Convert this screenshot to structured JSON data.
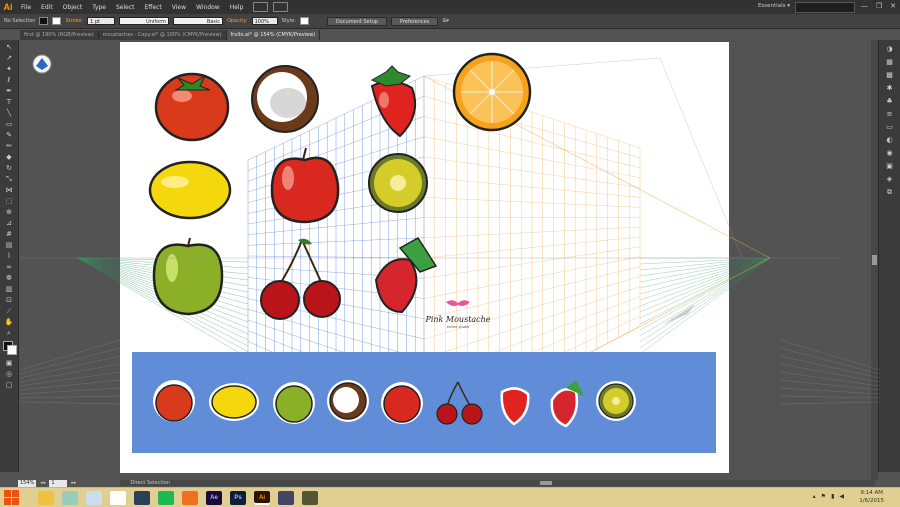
{
  "app": {
    "logo": "Ai"
  },
  "menu": [
    "File",
    "Edit",
    "Object",
    "Type",
    "Select",
    "Effect",
    "View",
    "Window",
    "Help"
  ],
  "workspace": {
    "label": "Essentials ▾",
    "search_placeholder": ""
  },
  "window_buttons": {
    "minimize": "—",
    "restore": "❐",
    "close": "✕"
  },
  "control_bar": {
    "selection": "No Selection",
    "stroke_label": "Stroke:",
    "stroke_weight": "1 pt",
    "profile": "Uniform",
    "brush": "Basic",
    "opacity_label": "Opacity:",
    "opacity_value": "100%",
    "style_label": "Style:",
    "doc_setup": "Document Setup",
    "preferences": "Preferences"
  },
  "tabs": [
    {
      "label": "first @ 190% (RGB/Preview)"
    },
    {
      "label": "moustaches · Copy.ai* @ 100% (CMYK/Preview)"
    },
    {
      "label": "fruits.ai* @ 154% (CMYK/Preview)"
    }
  ],
  "canvas": {
    "brand_name": "Pink Moustache",
    "brand_tagline": "online studio",
    "fruits_top": [
      "tomato",
      "coconut",
      "strawberry",
      "orange",
      "lemon",
      "apple",
      "kiwi",
      "green-apple",
      "cherries",
      "raspberry"
    ],
    "fruits_strip": [
      "tomato",
      "lemon",
      "green-apple",
      "coconut",
      "apple",
      "cherries",
      "strawberry",
      "raspberry",
      "kiwi"
    ],
    "colors": {
      "strip": "#5b88d6",
      "grid_left": "#3a6ad0",
      "grid_right": "#f0a84a",
      "ground": "#2f9a5e"
    }
  },
  "status": {
    "zoom": "154%",
    "page": "1",
    "tool": "Direct Selection"
  },
  "taskbar": {
    "apps": [
      {
        "label": "",
        "icon": "file-explorer-icon",
        "color": "#f0c040"
      },
      {
        "label": "",
        "icon": "network-icon",
        "color": "#9cb"
      },
      {
        "label": "",
        "icon": "notepad-icon",
        "color": "#cde"
      },
      {
        "label": "",
        "icon": "chrome-icon",
        "color": "#fff"
      },
      {
        "label": "",
        "icon": "steam-icon",
        "color": "#2a3f5a"
      },
      {
        "label": "",
        "icon": "spotify-icon",
        "color": "#1db954"
      },
      {
        "label": "",
        "icon": "media-player-icon",
        "color": "#f07020"
      },
      {
        "label": "Ae",
        "icon": "after-effects-icon",
        "color": "#1a0a3a"
      },
      {
        "label": "Ps",
        "icon": "photoshop-icon",
        "color": "#0b1e3a"
      },
      {
        "label": "Ai",
        "icon": "illustrator-icon",
        "color": "#2b1400"
      },
      {
        "label": "",
        "icon": "app-icon",
        "color": "#446"
      },
      {
        "label": "",
        "icon": "app-icon-2",
        "color": "#553"
      }
    ],
    "time": "9:14 AM",
    "date": "1/6/2015"
  }
}
